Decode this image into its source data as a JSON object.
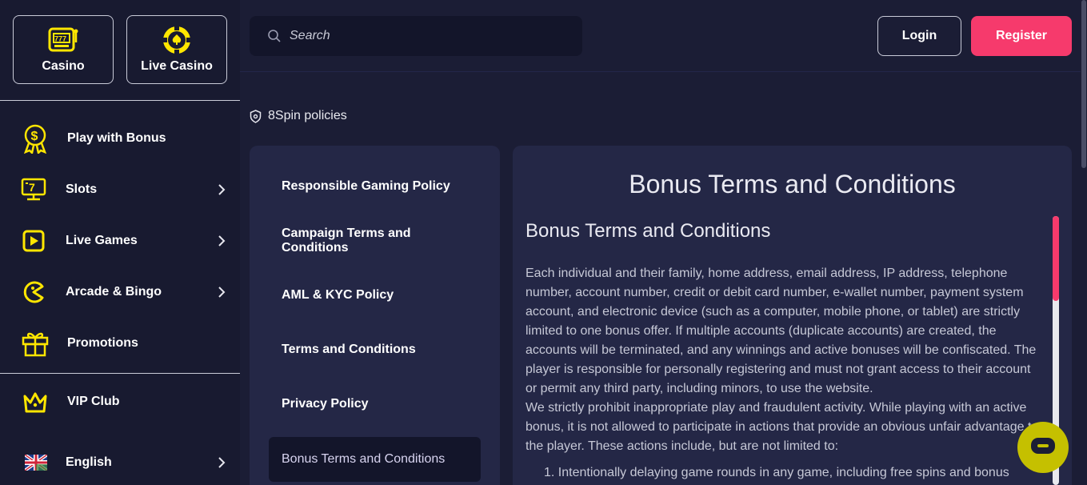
{
  "sidebar": {
    "tiles": [
      {
        "label": "Casino",
        "icon": "slot-machine-icon"
      },
      {
        "label": "Live Casino",
        "icon": "poker-chip-icon"
      }
    ],
    "items": [
      {
        "label": "Play with Bonus",
        "icon": "bonus-medal-icon",
        "has_chevron": false
      },
      {
        "label": "Slots",
        "icon": "slots-icon",
        "has_chevron": true
      },
      {
        "label": "Live Games",
        "icon": "play-icon",
        "has_chevron": true
      },
      {
        "label": "Arcade & Bingo",
        "icon": "pacman-icon",
        "has_chevron": true
      },
      {
        "label": "Promotions",
        "icon": "gift-icon",
        "has_chevron": false
      },
      {
        "label": "VIP Club",
        "icon": "crown-icon",
        "has_chevron": false
      },
      {
        "label": "English",
        "icon": "uk-flag-icon",
        "has_chevron": true
      }
    ]
  },
  "header": {
    "search_placeholder": "Search",
    "login_label": "Login",
    "register_label": "Register"
  },
  "breadcrumb": "8Spin policies",
  "policies": [
    {
      "label": "Responsible Gaming Policy",
      "active": false
    },
    {
      "label": "Campaign Terms and Conditions",
      "active": false
    },
    {
      "label": "AML & KYC Policy",
      "active": false
    },
    {
      "label": "Terms and Conditions",
      "active": false
    },
    {
      "label": "Privacy Policy",
      "active": false
    },
    {
      "label": "Bonus Terms and Conditions",
      "active": true
    }
  ],
  "content": {
    "title": "Bonus Terms and Conditions",
    "subtitle": "Bonus Terms and Conditions",
    "paragraph1": "Each individual and their family, home address, email address, IP address, telephone number, account number, credit or debit card number, e-wallet number, payment system account, and electronic device (such as a computer, mobile phone, or tablet) are strictly limited to one bonus offer. If multiple accounts (duplicate accounts) are created, the accounts will be terminated, and any winnings and active bonuses will be confiscated. The player is responsible for personally registering and must not grant access to their account or permit any third party, including minors, to use the website.",
    "paragraph2": "We strictly prohibit inappropriate play and fraudulent activity. While playing with an active bonus, it is not allowed to participate in actions that provide an obvious unfair advantage to the player. These actions include, but are not limited to:",
    "list_item1": "1. Intentionally delaying game rounds in any game, including free spins and bonus"
  },
  "colors": {
    "accent": "#f63a6c",
    "icon_yellow": "#ffe600",
    "chat": "#c5c000"
  }
}
